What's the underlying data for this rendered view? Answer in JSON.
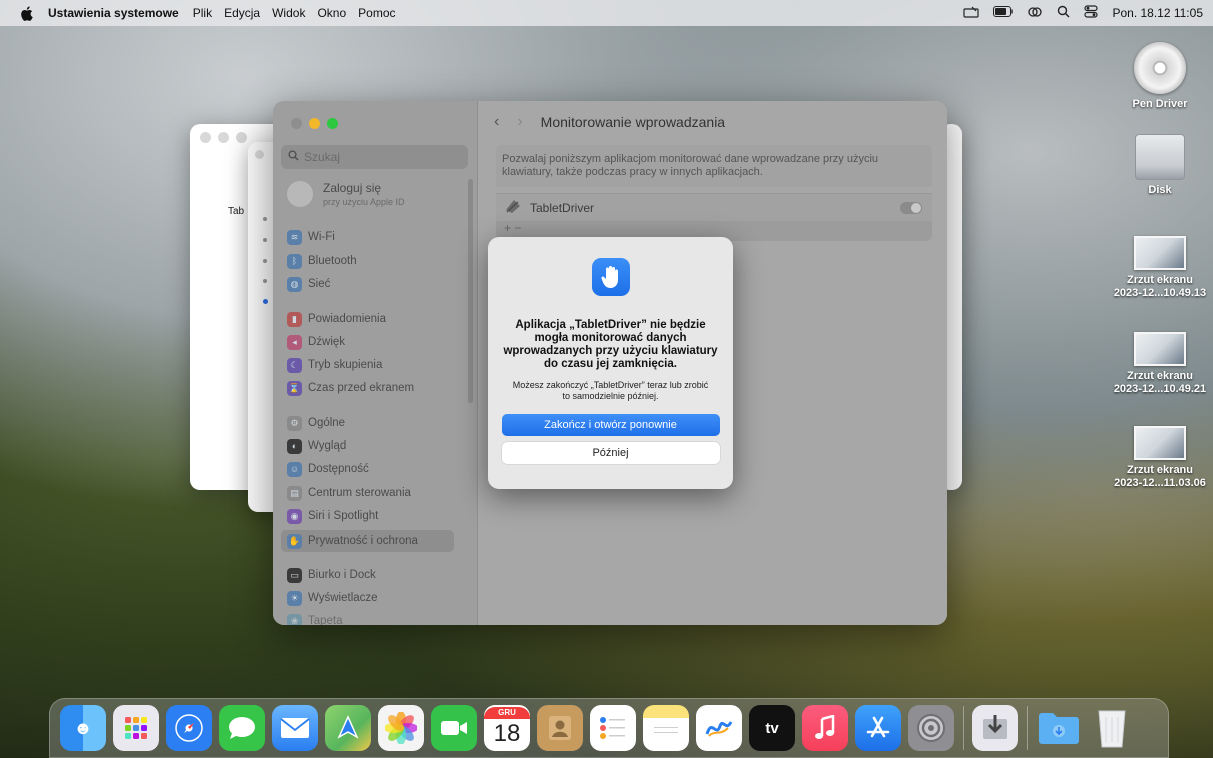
{
  "menubar": {
    "app_name": "Ustawienia systemowe",
    "items": [
      "Plik",
      "Edycja",
      "Widok",
      "Okno",
      "Pomoc"
    ],
    "datetime": "Pon. 18.12  11:05"
  },
  "desktop": {
    "icons": [
      {
        "label": "Pen Driver",
        "icon": "cd-icon"
      },
      {
        "label": "Disk",
        "icon": "disk-icon"
      },
      {
        "label": "Zrzut ekranu\n2023-12...10.49.13",
        "icon": "screenshot-icon"
      },
      {
        "label": "Zrzut ekranu\n2023-12...10.49.21",
        "icon": "screenshot-icon"
      },
      {
        "label": "Zrzut ekranu\n2023-12...11.03.06",
        "icon": "screenshot-icon"
      }
    ]
  },
  "bg_window": {
    "label": "Tab"
  },
  "settings": {
    "search_placeholder": "Szukaj",
    "account": {
      "line1": "Zaloguj się",
      "line2": "przy użyciu Apple ID"
    },
    "sidebar": [
      {
        "label": "Wi-Fi",
        "color": "#5a7fa8"
      },
      {
        "label": "Bluetooth",
        "color": "#5a7fa8"
      },
      {
        "label": "Sieć",
        "color": "#5a7fa8"
      },
      {
        "label": "Powiadomienia",
        "color": "#b25a5a"
      },
      {
        "label": "Dźwięk",
        "color": "#b25a7a"
      },
      {
        "label": "Tryb skupienia",
        "color": "#6a5aa8"
      },
      {
        "label": "Czas przed ekranem",
        "color": "#6a5aa8"
      },
      {
        "label": "Ogólne",
        "color": "#8a8a8a"
      },
      {
        "label": "Wygląd",
        "color": "#3a3a3a"
      },
      {
        "label": "Dostępność",
        "color": "#5a7fa8"
      },
      {
        "label": "Centrum sterowania",
        "color": "#8a8a8a"
      },
      {
        "label": "Siri i Spotlight",
        "color": "#7a5aa8"
      },
      {
        "label": "Prywatność i ochrona",
        "color": "#5a7fa8"
      },
      {
        "label": "Biurko i Dock",
        "color": "#3a3a3a"
      },
      {
        "label": "Wyświetlacze",
        "color": "#5a7fa8"
      },
      {
        "label": "Tapeta",
        "color": "#5a8fa8"
      }
    ],
    "selected_index": 12,
    "page_title": "Monitorowanie wprowadzania",
    "description": "Pozwalaj poniższym aplikacjom monitorować dane wprowadzane przy użyciu klawiatury, także podczas pracy w innych aplikacjach.",
    "app_name": "TabletDriver",
    "add_remove": "+  −"
  },
  "dialog": {
    "title": "Aplikacja „TabletDriver” nie będzie mogła monitorować danych wprowadzanych przy użyciu klawiatury do czasu jej zamknięcia.",
    "message": "Możesz zakończyć „TabletDriver” teraz lub zrobić to samodzielnie później.",
    "primary_button": "Zakończ i otwórz ponownie",
    "secondary_button": "Później"
  },
  "dock": {
    "calendar_month": "GRU",
    "calendar_day": "18",
    "tv_label": "tv",
    "apps": [
      {
        "name": "finder-icon",
        "color": "#2f8cf0"
      },
      {
        "name": "launchpad-icon",
        "color": "#e8e8ee"
      },
      {
        "name": "safari-icon",
        "color": "#2b7ff3"
      },
      {
        "name": "messages-icon",
        "color": "#36c449"
      },
      {
        "name": "mail-icon",
        "color": "#3b90f2"
      },
      {
        "name": "maps-icon",
        "color": "#58b55d"
      },
      {
        "name": "photos-icon",
        "color": "#f4f4f4"
      },
      {
        "name": "facetime-icon",
        "color": "#34c24a"
      },
      {
        "name": "calendar-icon",
        "color": "#ffffff"
      },
      {
        "name": "contacts-icon",
        "color": "#c79a5e"
      },
      {
        "name": "reminders-icon",
        "color": "#ffffff"
      },
      {
        "name": "notes-icon",
        "color": "#fbe27a"
      },
      {
        "name": "freeform-icon",
        "color": "#ffffff"
      },
      {
        "name": "tv-icon",
        "color": "#111111"
      },
      {
        "name": "music-icon",
        "color": "#f5405a"
      },
      {
        "name": "app-store-icon",
        "color": "#2a8af5"
      },
      {
        "name": "system-settings-icon",
        "color": "#8e8e93"
      }
    ]
  }
}
